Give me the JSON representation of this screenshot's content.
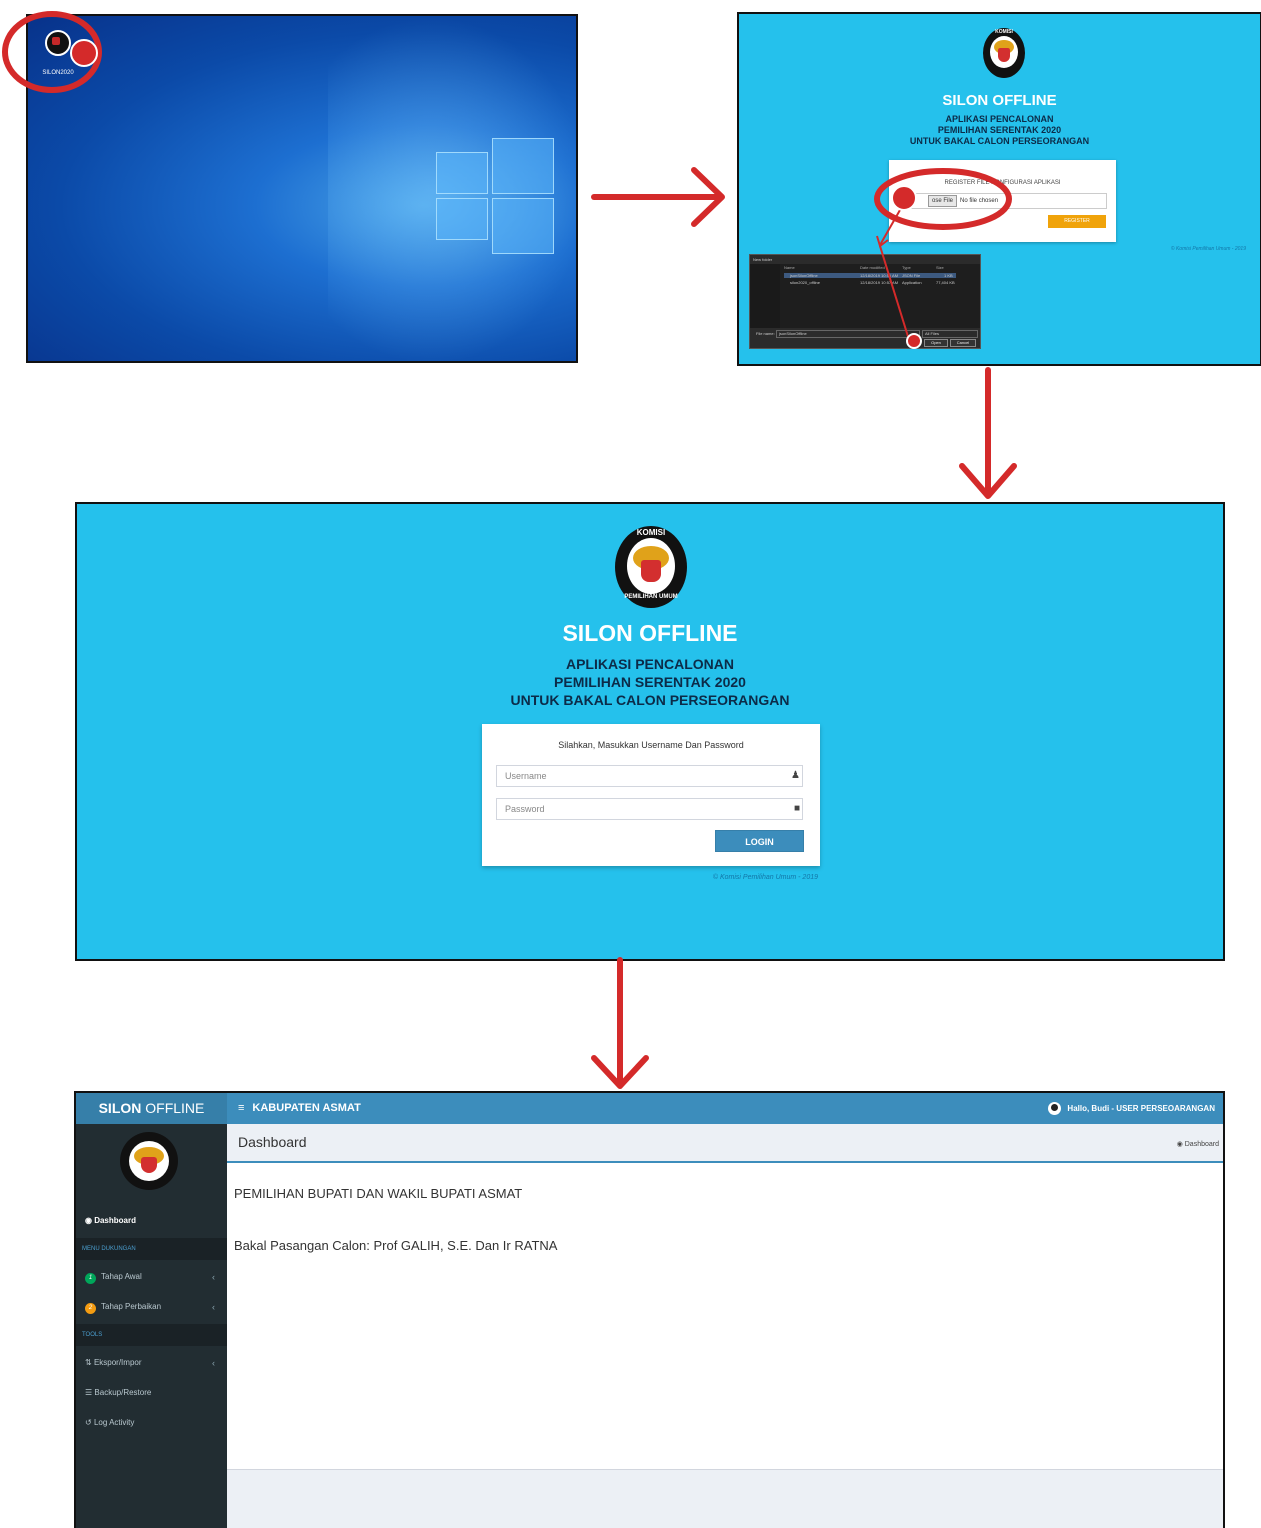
{
  "desktop": {
    "shortcut_label": "SILON2020"
  },
  "register": {
    "logo_text": "KOMISI",
    "logo_text2": "PEMILIHAN UMUM",
    "title": "SILON OFFLINE",
    "subtitle_1": "APLIKASI PENCALONAN",
    "subtitle_2": "PEMILIHAN SERENTAK 2020",
    "subtitle_3": "UNTUK BAKAL CALON PERSEORANGAN",
    "box_caption": "REGISTER FILE KONFIGURASI APLIKASI",
    "choose_file_label": "ose File",
    "no_file_label": "No file chosen",
    "register_button": "REGISTER",
    "copyright": "© Komisi Pemilihan Umum - 2019",
    "file_dialog": {
      "new_folder": "New folder",
      "columns": [
        "Name",
        "Date modified",
        "Type",
        "Size"
      ],
      "rows": [
        {
          "name": "jsonSilonOffline",
          "date": "12/18/2019 10:56 AM",
          "type": "JSON File",
          "size": "1 KB"
        },
        {
          "name": "silon2020_offline",
          "date": "12/18/2019 10:57 AM",
          "type": "Application",
          "size": "77,404 KB"
        }
      ],
      "file_name_label": "File name:",
      "file_name_value": "jsonSilonOffline",
      "filter": "All Files",
      "open_button": "Open",
      "cancel_button": "Cancel"
    }
  },
  "login": {
    "logo_text": "KOMISI",
    "logo_text2": "PEMILIHAN UMUM",
    "title": "SILON OFFLINE",
    "subtitle_1": "APLIKASI PENCALONAN",
    "subtitle_2": "PEMILIHAN SERENTAK 2020",
    "subtitle_3": "UNTUK BAKAL CALON PERSEORANGAN",
    "box_caption": "Silahkan, Masukkan Username Dan Password",
    "username_placeholder": "Username",
    "password_placeholder": "Password",
    "login_button": "LOGIN",
    "copyright": "© Komisi Pemilihan Umum - 2019"
  },
  "dashboard": {
    "brand_bold": "SILON",
    "brand_light": " OFFLINE",
    "menu_icon": "≡",
    "region": "KABUPATEN ASMAT",
    "user_greeting": "Hallo, Budi - USER PERSEOARANGAN",
    "sidebar": {
      "dashboard": "Dashboard",
      "section_menu": "MENU DUKUNGAN",
      "tahap_awal": "Tahap Awal",
      "tahap_awal_badge": "1",
      "tahap_perbaikan": "Tahap Perbaikan",
      "tahap_perbaikan_badge": "2",
      "section_tools": "TOOLS",
      "ekspor": "Ekspor/Impor",
      "backup": "Backup/Restore",
      "log": "Log Activity"
    },
    "page_title": "Dashboard",
    "breadcrumb": "Dashboard",
    "line1": "PEMILIHAN BUPATI DAN WAKIL BUPATI ASMAT",
    "line2": "Bakal Pasangan Calon: Prof GALIH, S.E. Dan Ir RATNA"
  },
  "colors": {
    "cyan_bg": "#25c1ec",
    "adminlte_blue": "#3c8dbc",
    "sidebar_dark": "#222d32",
    "annotation_red": "#d42a2a",
    "register_orange": "#f0a30a"
  }
}
